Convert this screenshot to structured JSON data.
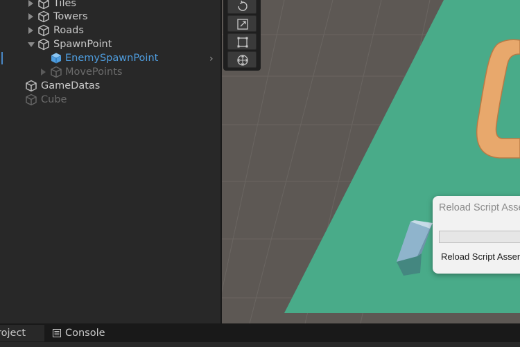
{
  "hierarchy": {
    "items": [
      {
        "label": "Tiles",
        "state": "closed",
        "style": "normal"
      },
      {
        "label": "Towers",
        "state": "closed",
        "style": "normal"
      },
      {
        "label": "Roads",
        "state": "closed",
        "style": "normal"
      },
      {
        "label": "SpawnPoint",
        "state": "open",
        "style": "normal"
      },
      {
        "label": "EnemySpawnPoint",
        "state": "none",
        "style": "selected"
      },
      {
        "label": "MovePoints",
        "state": "closed",
        "style": "dim"
      },
      {
        "label": "GameDatas",
        "state": "none",
        "style": "normal"
      },
      {
        "label": "Cube",
        "state": "none",
        "style": "dim"
      }
    ],
    "expand_arrow": "›"
  },
  "tools": [
    "rotate-tool",
    "scale-tool",
    "rect-tool",
    "transform-tool"
  ],
  "dialog": {
    "title": "Reload Script Asse",
    "status": "Reload Script Assem"
  },
  "tabs": {
    "project": "roject",
    "console": "Console"
  },
  "colors": {
    "panel": "#282828",
    "scene_ground": "#5d5854",
    "plane": "#49ab89",
    "path": "#e8a86c",
    "selection": "#4f9ee0"
  }
}
